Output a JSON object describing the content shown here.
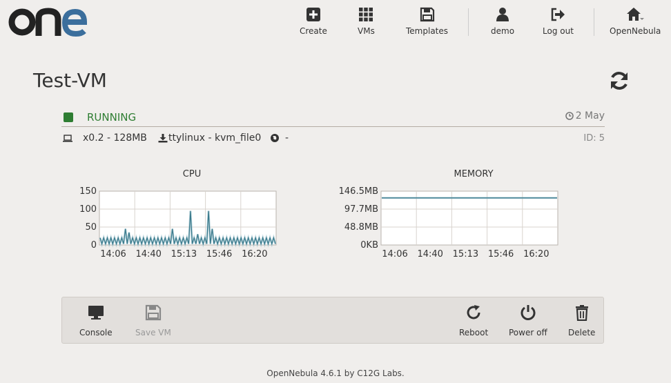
{
  "header": {
    "logo_text": "one",
    "nav": [
      {
        "label": "Create",
        "icon": "plus-square-icon"
      },
      {
        "label": "VMs",
        "icon": "grid-icon"
      },
      {
        "label": "Templates",
        "icon": "save-icon"
      },
      {
        "label": "demo",
        "icon": "user-icon"
      },
      {
        "label": "Log out",
        "icon": "sign-out-icon"
      },
      {
        "label": "OpenNebula",
        "icon": "home-icon"
      }
    ]
  },
  "vm": {
    "name": "Test-VM",
    "state": "RUNNING",
    "state_color": "#2e7d32",
    "date": "2 May",
    "capacity": "x0.2 - 128MB",
    "disk": "ttylinux - kvm_file0",
    "network": "-",
    "id": "ID: 5"
  },
  "charts": {
    "cpu_title": "CPU",
    "memory_title": "MEMORY"
  },
  "chart_data": [
    {
      "type": "line",
      "title": "CPU",
      "ylim": [
        0,
        150
      ],
      "yticks": [
        "150",
        "100",
        "50",
        "0"
      ],
      "xticks": [
        "14:06",
        "14:40",
        "15:13",
        "15:46",
        "16:20"
      ],
      "grid": true,
      "series": [
        {
          "color": "#3a7a8c",
          "values": [
            20,
            3,
            20,
            3,
            20,
            3,
            20,
            3,
            20,
            3,
            20,
            3,
            20,
            3,
            45,
            3,
            35,
            3,
            20,
            3,
            20,
            3,
            20,
            3,
            20,
            3,
            20,
            3,
            20,
            3,
            20,
            3,
            20,
            3,
            20,
            3,
            20,
            3,
            20,
            3,
            45,
            3,
            20,
            3,
            20,
            3,
            20,
            3,
            20,
            3,
            95,
            3,
            20,
            3,
            30,
            3,
            20,
            3,
            20,
            3,
            95,
            3,
            45,
            3,
            20,
            3,
            20,
            3,
            20,
            3,
            20,
            3,
            20,
            3,
            20,
            3,
            20,
            3,
            20,
            3,
            20,
            3,
            20,
            3,
            20,
            3,
            20,
            3,
            20,
            3,
            20,
            3,
            20,
            3,
            20,
            3,
            20,
            3
          ]
        }
      ]
    },
    {
      "type": "line",
      "title": "MEMORY",
      "ylim": [
        0,
        146.5
      ],
      "yticks": [
        "146.5MB",
        "97.7MB",
        "48.8MB",
        "0KB"
      ],
      "xticks": [
        "14:06",
        "14:40",
        "15:13",
        "15:46",
        "16:20"
      ],
      "grid": true,
      "series": [
        {
          "color": "#3a7a8c",
          "values": [
            128,
            128,
            128,
            128,
            128,
            128,
            128,
            128,
            128,
            128
          ]
        }
      ]
    }
  ],
  "actions": [
    {
      "label": "Console",
      "icon": "monitor-icon",
      "enabled": true
    },
    {
      "label": "Save VM",
      "icon": "save-icon",
      "enabled": false
    },
    {
      "label": "Reboot",
      "icon": "reboot-icon",
      "enabled": true
    },
    {
      "label": "Power off",
      "icon": "power-icon",
      "enabled": true
    },
    {
      "label": "Delete",
      "icon": "trash-icon",
      "enabled": true
    }
  ],
  "footer": "OpenNebula 4.6.1 by C12G Labs."
}
